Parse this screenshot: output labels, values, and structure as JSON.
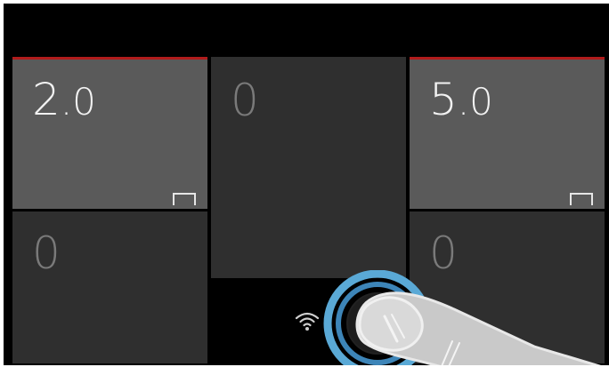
{
  "zones": [
    {
      "id": "front-left",
      "level_int": "2",
      "level_dec": ".0",
      "active": true
    },
    {
      "id": "rear-left",
      "level_int": "0",
      "level_dec": "",
      "active": false
    },
    {
      "id": "center",
      "level_int": "0",
      "level_dec": "",
      "active": false
    },
    {
      "id": "front-right",
      "level_int": "5",
      "level_dec": ".0",
      "active": true
    },
    {
      "id": "rear-right",
      "level_int": "0",
      "level_dec": "",
      "active": false
    }
  ],
  "icons": {
    "pair": "zone-pair-icon",
    "wireless": "wifi-icon",
    "touch_hint": "finger-press-icon"
  },
  "colors": {
    "background": "#000000",
    "active_zone": "#5a5a5a",
    "inactive_zone": "#2f2f2f",
    "active_indicator": "#b11c1c",
    "touch_ring": "#5aa9d6"
  }
}
